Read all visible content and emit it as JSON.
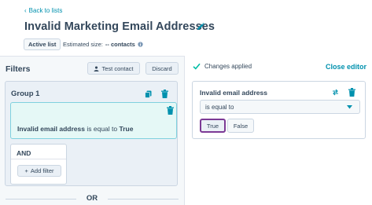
{
  "header": {
    "back_label": "Back to lists",
    "title": "Invalid Marketing Email Addresses",
    "status_badge": "Active list",
    "estimated_size_label": "Estimated size:",
    "estimated_size_value": "-- contacts"
  },
  "filters": {
    "title": "Filters",
    "test_contact_label": "Test contact",
    "discard_label": "Discard",
    "group": {
      "title": "Group 1",
      "filter": {
        "property": "Invalid email address",
        "operator": "is equal to",
        "value": "True"
      },
      "and_label": "AND",
      "add_filter_label": "Add filter"
    },
    "or_label": "OR"
  },
  "editor": {
    "status": "Changes applied",
    "close_label": "Close editor",
    "property_title": "Invalid email address",
    "operator_value": "is equal to",
    "options": [
      "True",
      "False"
    ],
    "selected_option": "True"
  },
  "colors": {
    "link": "#0091ae",
    "selected_border": "#7c3a95",
    "filter_highlight": "#e5f8f6",
    "success_check": "#00bda5"
  },
  "icons": {
    "pencil": "pencil-icon",
    "info": "info-icon",
    "person": "person-icon",
    "copy": "copy-icon",
    "trash": "trash-icon",
    "check": "check-icon",
    "swap": "swap-icon",
    "caret": "caret-down-icon",
    "plus": "plus-icon"
  }
}
